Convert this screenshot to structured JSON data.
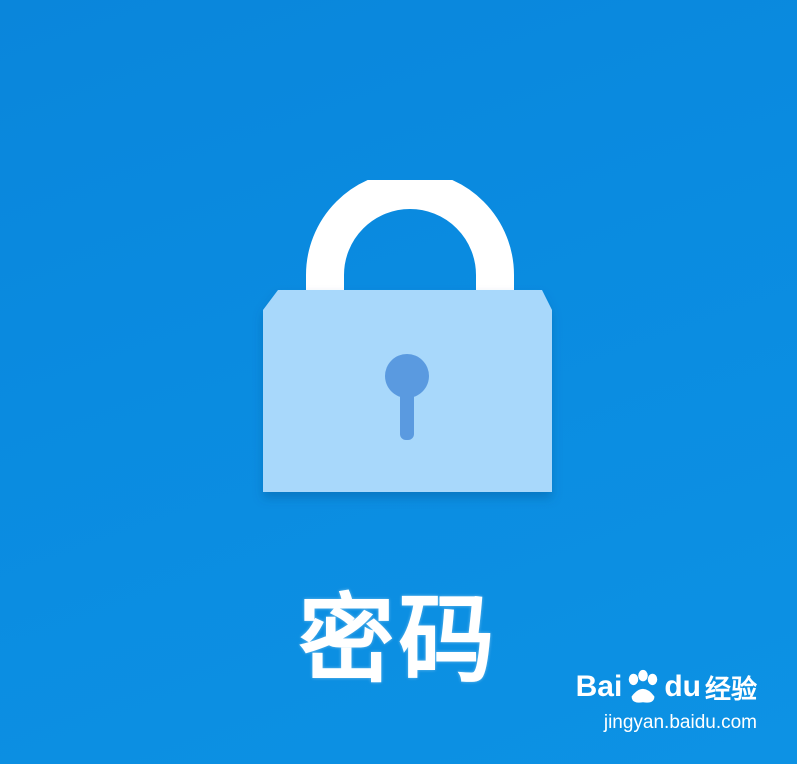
{
  "tile": {
    "label": "密码",
    "icon": "lock-icon",
    "background": "#0a8be0",
    "icon_body_color": "#a8d8fb",
    "icon_shackle_color": "#ffffff",
    "keyhole_color": "#5a9ae0"
  },
  "watermark": {
    "brand_left": "Bai",
    "brand_icon": "paw-icon",
    "brand_right": "du",
    "product": "经验",
    "url": "jingyan.baidu.com"
  }
}
